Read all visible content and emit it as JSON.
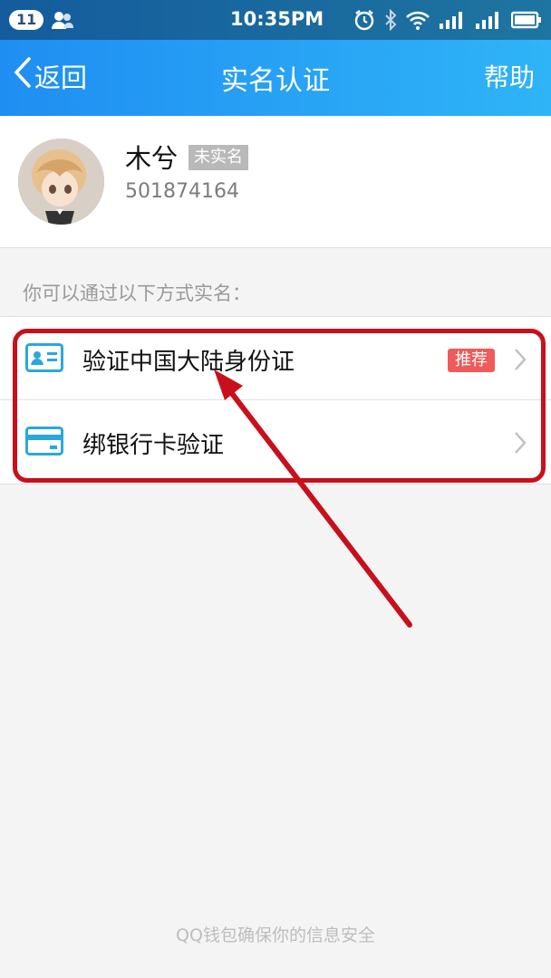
{
  "status_bar": {
    "notification_count": "11",
    "time": "10:35PM",
    "icons": [
      "contacts-icon",
      "alarm-icon",
      "bluetooth-icon",
      "wifi-icon",
      "signal-icon",
      "battery-icon"
    ]
  },
  "nav": {
    "back_label": "返回",
    "title": "实名认证",
    "help_label": "帮助"
  },
  "profile": {
    "name": "木兮",
    "status_badge": "未实名",
    "qq_number": "501874164"
  },
  "hint": "你可以通过以下方式实名：",
  "methods": [
    {
      "label": "验证中国大陆身份证",
      "badge": "推荐",
      "icon": "id-card-icon"
    },
    {
      "label": "绑银行卡验证",
      "icon": "bank-card-icon"
    }
  ],
  "footer": "QQ钱包确保你的信息安全",
  "colors": {
    "header_start": "#1f8ef2",
    "header_end": "#2fb4f7",
    "icon_blue": "#2aa7dc",
    "recommend_red": "#f05a5a",
    "annotation_red": "#c8101c"
  }
}
